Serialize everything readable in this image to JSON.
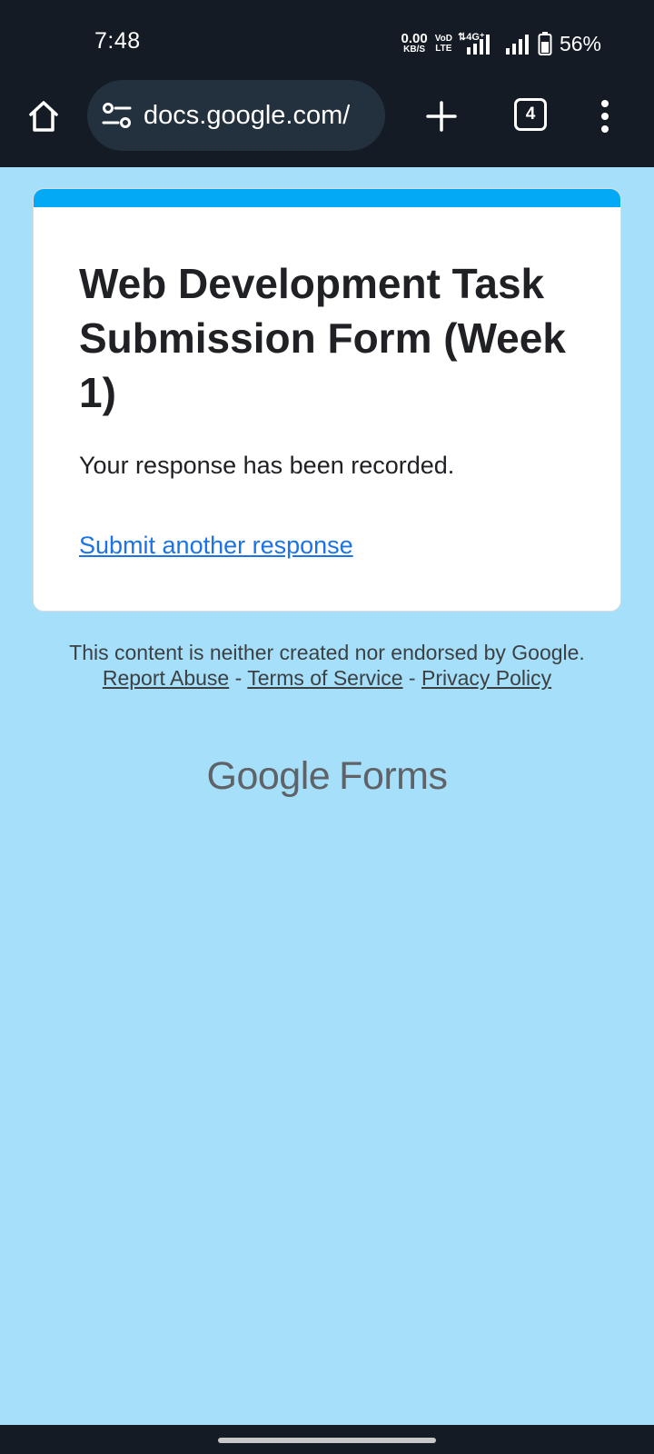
{
  "status_bar": {
    "time": "7:48",
    "net_speed_value": "0.00",
    "net_speed_unit": "KB/S",
    "volte_top": "VoD",
    "volte_bottom": "LTE",
    "network_type": "4G",
    "battery_percent": "56%"
  },
  "browser": {
    "url": "docs.google.com/",
    "tab_count": "4"
  },
  "form": {
    "title": "Web Development Task Submission Form (Week 1)",
    "confirmation": "Your response has been recorded.",
    "submit_another": "Submit another response",
    "accent_color": "#03a9f4"
  },
  "footer": {
    "disclaimer_prefix": "This content is neither created nor endorsed by Google.",
    "report_abuse": "Report Abuse",
    "separator": "-",
    "terms": "Terms of Service",
    "privacy": "Privacy Policy"
  },
  "branding": {
    "google": "Google",
    "forms": "Forms"
  },
  "colors": {
    "page_background": "#a5dffa",
    "chrome_background": "#141b24",
    "link": "#1a73e8"
  }
}
